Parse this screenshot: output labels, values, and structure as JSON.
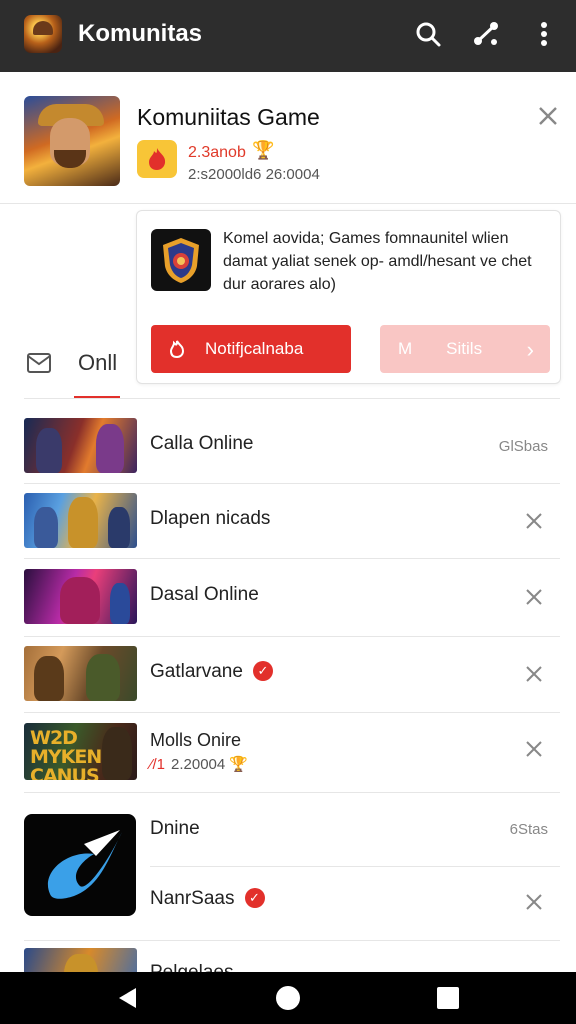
{
  "app_bar": {
    "title": "Komunitas",
    "actions": [
      "search-icon",
      "share-icon",
      "more-vert-icon"
    ],
    "background": "#2d2d2d"
  },
  "header": {
    "game_title": "Komuniitas Game",
    "rating": "2.3anob",
    "meta": "2:s2000ld6  26:0004"
  },
  "popup": {
    "text": "Komel aovida; Games fomnaunitel wlien damat yaliat senek op- amdl/hesant ve chet dur aorares alo)",
    "primary_button": "Notifjcalnaba",
    "secondary_prefix": "M",
    "secondary_button": "Sitils"
  },
  "tabs": {
    "active_label": "Onll"
  },
  "list": [
    {
      "name": "Calla Online",
      "right_text": "GlSbas"
    },
    {
      "name": "Dlapen nicads"
    },
    {
      "name": "Dasal Online"
    },
    {
      "name": "Gatlarvane",
      "verified": true
    },
    {
      "name": "Molls Onire",
      "sub_hot": "⁄/1",
      "sub": "2.20004",
      "thumb_text": "W2D MYKEN CANUS"
    },
    {
      "name": "Dnine",
      "right_text": "6Stas"
    },
    {
      "name": "NanrSaas",
      "verified": true
    },
    {
      "name": "Pelgelaes"
    }
  ],
  "colors": {
    "accent": "#e2302b",
    "accent_light": "#f9c6c4",
    "text": "#222222",
    "divider": "#e6e6e6"
  }
}
